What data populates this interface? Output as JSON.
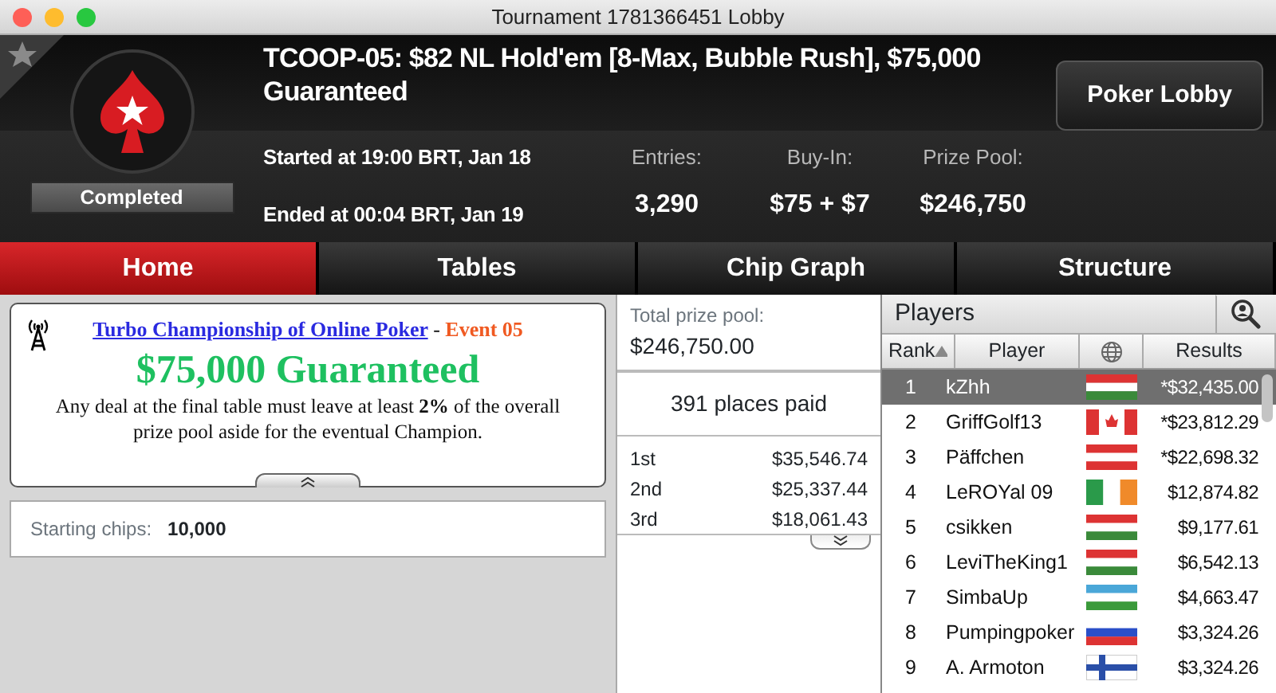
{
  "window": {
    "title": "Tournament 1781366451 Lobby"
  },
  "header": {
    "title": "TCOOP-05: $82 NL Hold'em [8-Max, Bubble Rush], $75,000 Guaranteed",
    "status": "Completed",
    "started": "Started at 19:00 BRT, Jan 18",
    "ended": "Ended at 00:04 BRT, Jan 19",
    "lobby_button": "Poker Lobby",
    "stats": [
      {
        "label": "Entries:",
        "value": "3,290"
      },
      {
        "label": "Buy-In:",
        "value": "$75 + $7"
      },
      {
        "label": "Prize Pool:",
        "value": "$246,750"
      }
    ]
  },
  "tabs": [
    {
      "label": "Home",
      "selected": true
    },
    {
      "label": "Tables",
      "selected": false
    },
    {
      "label": "Chip Graph",
      "selected": false
    },
    {
      "label": "Structure",
      "selected": false
    }
  ],
  "banner": {
    "link": "Turbo Championship of Online Poker",
    "separator": "-",
    "event": "Event 05",
    "headline": "$75,000 Guaranteed",
    "note": "Any deal at the final table must leave at least **2%** of the overall prize pool aside for the eventual Champion."
  },
  "starting_chips": {
    "label": "Starting chips:",
    "value": "10,000"
  },
  "prizes": {
    "total_label": "Total prize pool:",
    "total": "$246,750.00",
    "places_paid": "391 places paid",
    "rows": [
      {
        "place": "1st",
        "amount": "$35,546.74"
      },
      {
        "place": "2nd",
        "amount": "$25,337.44"
      },
      {
        "place": "3rd",
        "amount": "$18,061.43"
      }
    ]
  },
  "players": {
    "title": "Players",
    "columns": [
      "Rank",
      "Player",
      "Results"
    ],
    "rows": [
      {
        "rank": "1",
        "player": "kZhh",
        "kind": "hu",
        "result": "*$32,435.00",
        "selected": true
      },
      {
        "rank": "2",
        "player": "GriffGolf13",
        "kind": "ca",
        "result": "*$23,812.29",
        "selected": false
      },
      {
        "rank": "3",
        "player": "Päffchen",
        "kind": "at",
        "result": "*$22,698.32",
        "selected": false
      },
      {
        "rank": "4",
        "player": "LeROYal 09",
        "kind": "ie",
        "result": "$12,874.82",
        "selected": false
      },
      {
        "rank": "5",
        "player": "csikken",
        "kind": "hu",
        "result": "$9,177.61",
        "selected": false
      },
      {
        "rank": "6",
        "player": "LeviTheKing1",
        "kind": "hu",
        "result": "$6,542.13",
        "selected": false
      },
      {
        "rank": "7",
        "player": "SimbaUp",
        "kind": "uz",
        "result": "$4,663.47",
        "selected": false
      },
      {
        "rank": "8",
        "player": "Pumpingpoker",
        "kind": "ru",
        "result": "$3,324.26",
        "selected": false
      },
      {
        "rank": "9",
        "player": "A. Armoton",
        "kind": "fi",
        "result": "$3,324.26",
        "selected": false
      }
    ]
  }
}
